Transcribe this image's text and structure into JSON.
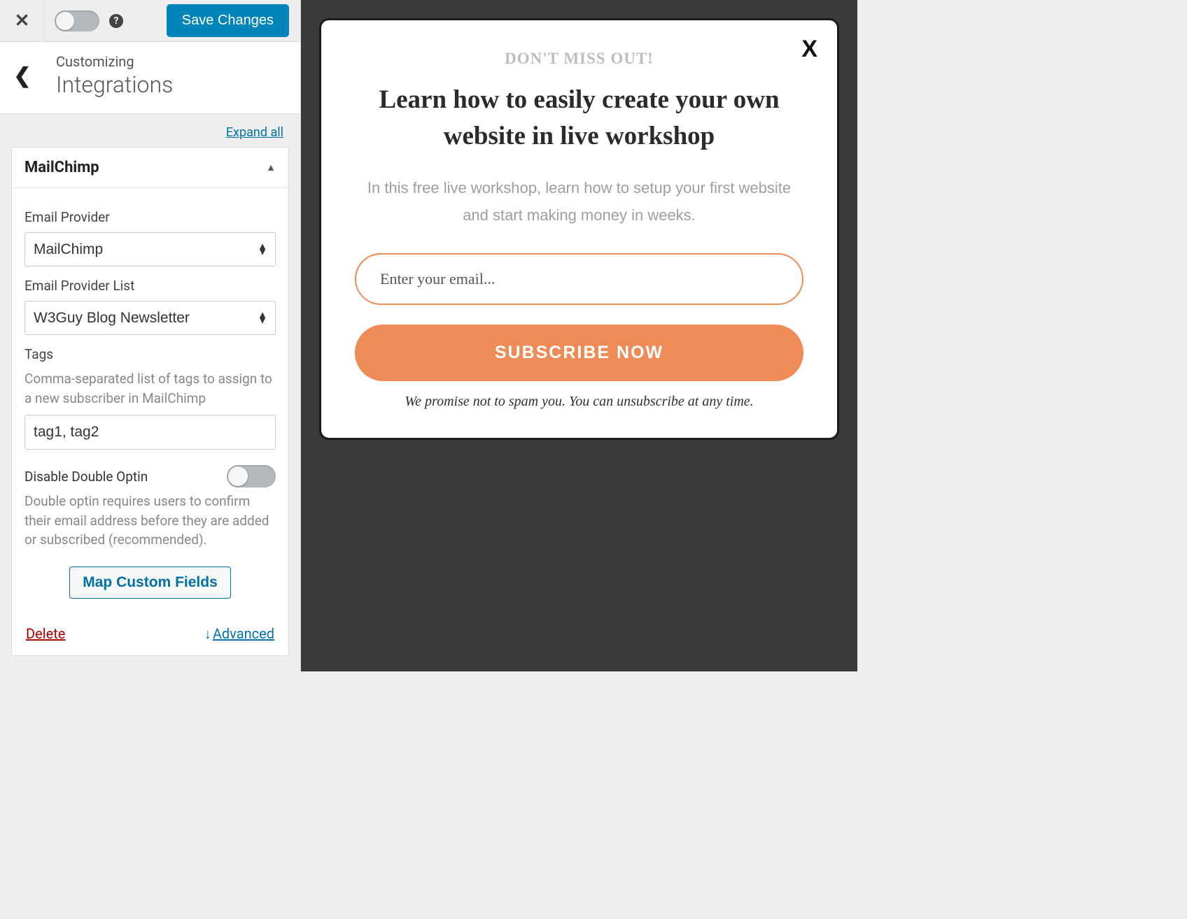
{
  "topbar": {
    "save_label": "Save Changes"
  },
  "header": {
    "crumb": "Customizing",
    "title": "Integrations"
  },
  "expand_label": "Expand all",
  "accordion": {
    "title": "MailChimp"
  },
  "fields": {
    "provider_label": "Email Provider",
    "provider_value": "MailChimp",
    "list_label": "Email Provider List",
    "list_value": "W3Guy Blog Newsletter",
    "tags_label": "Tags",
    "tags_help": "Comma-separated list of tags to assign to a new subscriber in MailChimp",
    "tags_value": "tag1, tag2",
    "double_optin_label": "Disable Double Optin",
    "double_optin_help": "Double optin requires users to confirm their email address before they are added or subscribed (recommended).",
    "map_button": "Map Custom Fields"
  },
  "footer": {
    "delete": "Delete",
    "advanced": "Advanced"
  },
  "popup": {
    "kicker": "DON'T MISS OUT!",
    "headline": "Learn how to easily create your own website in live workshop",
    "subtext": "In this free live workshop, learn how to setup your first website and start making money in weeks.",
    "email_placeholder": "Enter your email...",
    "cta": "SUBSCRIBE NOW",
    "fineprint": "We promise not to spam you. You can unsubscribe at any time."
  }
}
